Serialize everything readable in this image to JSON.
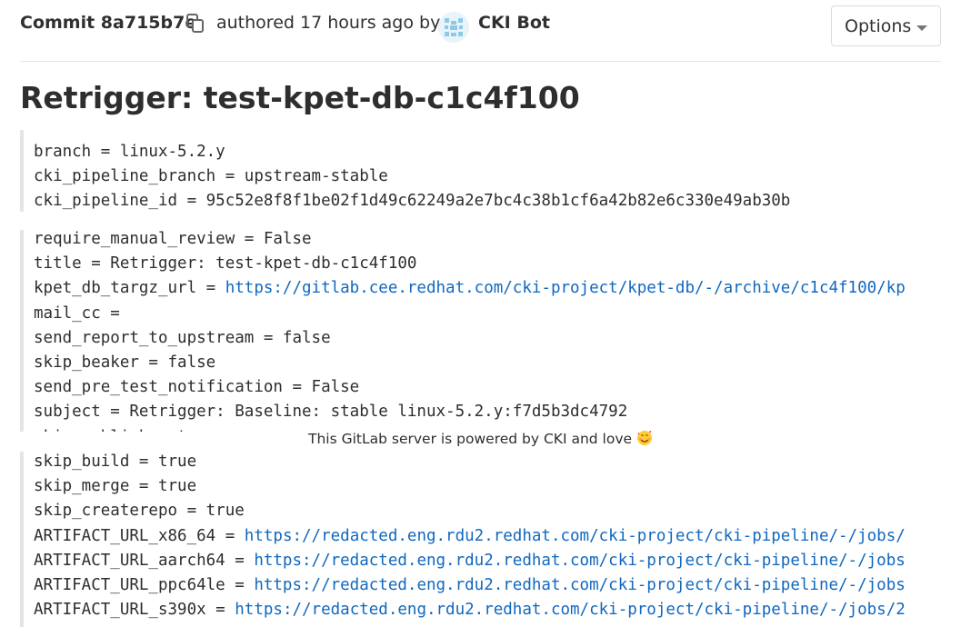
{
  "header": {
    "commit_label": "Commit 8a715b7e",
    "authored_text": "authored 17 hours ago by",
    "author_name": "CKI Bot",
    "options_label": "Options"
  },
  "title": "Retrigger: test-kpet-db-c1c4f100",
  "block1": [
    {
      "text": "branch = linux-5.2.y"
    },
    {
      "text": "cki_pipeline_branch = upstream-stable"
    },
    {
      "text": "cki_pipeline_id = 95c52e8f8f1be02f1d49c62249a2e7bc4c38b1cf6a42b82e6c330e49ab30b"
    }
  ],
  "block2": [
    {
      "text": "require_manual_review = False"
    },
    {
      "text": "title = Retrigger: test-kpet-db-c1c4f100"
    },
    {
      "text": "kpet_db_targz_url = ",
      "link": "https://gitlab.cee.redhat.com/cki-project/kpet-db/-/archive/c1c4f100/kp"
    },
    {
      "text": "mail_cc ="
    },
    {
      "text": "send_report_to_upstream = false"
    },
    {
      "text": "skip_beaker = false"
    },
    {
      "text": "send_pre_test_notification = False"
    },
    {
      "text": "subject = Retrigger: Baseline: stable linux-5.2.y:f7d5b3dc4792"
    },
    {
      "text": "skip_publish = true"
    }
  ],
  "footer_message": "This GitLab server is powered by CKI and love",
  "block3": [
    {
      "text": "skip_build = true"
    },
    {
      "text": "skip_merge = true"
    },
    {
      "text": "skip_createrepo = true"
    },
    {
      "text": "ARTIFACT_URL_x86_64 = ",
      "link": "https://redacted.eng.rdu2.redhat.com/cki-project/cki-pipeline/-/jobs/"
    },
    {
      "text": "ARTIFACT_URL_aarch64 = ",
      "link": "https://redacted.eng.rdu2.redhat.com/cki-project/cki-pipeline/-/jobs"
    },
    {
      "text": "ARTIFACT_URL_ppc64le = ",
      "link": "https://redacted.eng.rdu2.redhat.com/cki-project/cki-pipeline/-/jobs"
    },
    {
      "text": "ARTIFACT_URL_s390x = ",
      "link": "https://redacted.eng.rdu2.redhat.com/cki-project/cki-pipeline/-/jobs/2"
    }
  ],
  "colors": {
    "link": "#1068bf",
    "text": "#2e2e2e",
    "quote_border": "#e5e5e5",
    "divider": "#e5e5e5"
  },
  "icons": {
    "copy": "copy-icon",
    "avatar": "avatar-identicon",
    "caret": "chevron-down-icon",
    "emoji": "smiling-face-with-hearts-icon"
  }
}
